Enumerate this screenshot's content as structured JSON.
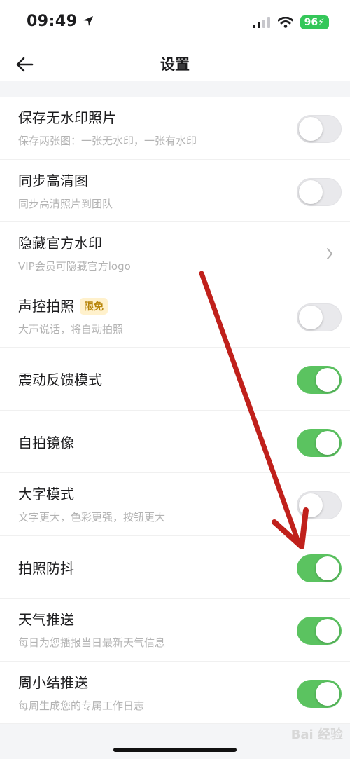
{
  "status_bar": {
    "time": "09:49",
    "battery": "96"
  },
  "nav": {
    "title": "设置"
  },
  "settings": [
    {
      "title": "保存无水印照片",
      "subtitle": "保存两张图：一张无水印，一张有水印",
      "control": "toggle",
      "on": false
    },
    {
      "title": "同步高清图",
      "subtitle": "同步高清照片到团队",
      "control": "toggle",
      "on": false
    },
    {
      "title": "隐藏官方水印",
      "subtitle": "VIP会员可隐藏官方logo",
      "control": "chevron"
    },
    {
      "title": "声控拍照",
      "badge": "限免",
      "subtitle": "大声说话，将自动拍照",
      "control": "toggle",
      "on": false
    },
    {
      "title": "震动反馈模式",
      "subtitle": "",
      "control": "toggle",
      "on": true
    },
    {
      "title": "自拍镜像",
      "subtitle": "",
      "control": "toggle",
      "on": true
    },
    {
      "title": "大字模式",
      "subtitle": "文字更大，色彩更强，按钮更大",
      "control": "toggle",
      "on": false
    },
    {
      "title": "拍照防抖",
      "subtitle": "",
      "control": "toggle",
      "on": true
    },
    {
      "title": "天气推送",
      "subtitle": "每日为您播报当日最新天气信息",
      "control": "toggle",
      "on": true
    },
    {
      "title": "周小结推送",
      "subtitle": "每周生成您的专属工作日志",
      "control": "toggle",
      "on": true
    }
  ],
  "colors": {
    "toggle_on": "#5bc360",
    "toggle_off": "#e9e9ec",
    "arrow": "#c0201b"
  },
  "watermark": "Bai 经验"
}
